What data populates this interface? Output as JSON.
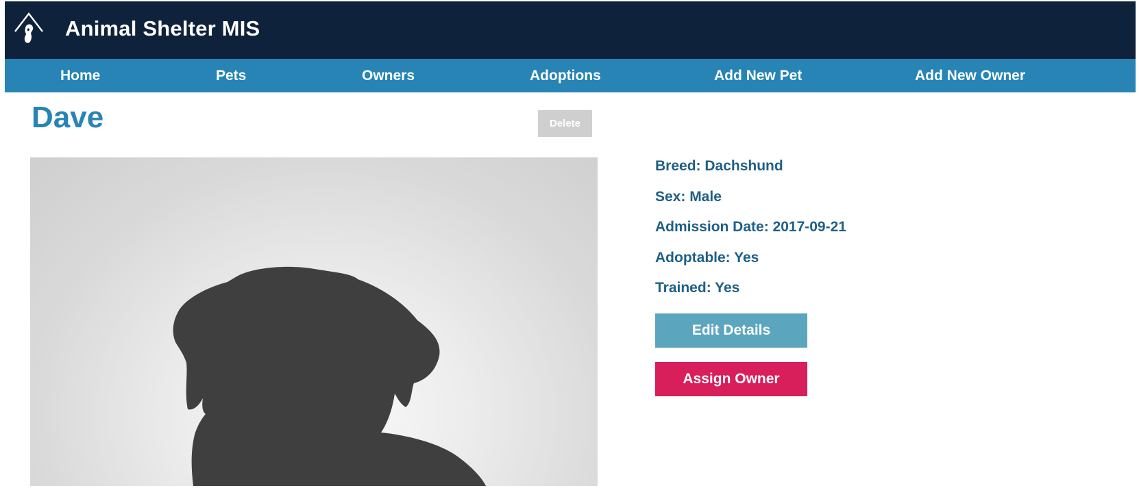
{
  "app": {
    "title": "Animal Shelter MIS",
    "logo_icon": "dog-house-logo-icon"
  },
  "nav": {
    "items": [
      {
        "label": "Home"
      },
      {
        "label": "Pets"
      },
      {
        "label": "Owners"
      },
      {
        "label": "Adoptions"
      },
      {
        "label": "Add New Pet"
      },
      {
        "label": "Add New Owner"
      }
    ]
  },
  "pet": {
    "name": "Dave",
    "photo_icon": "dog-silhouette-placeholder",
    "details": [
      {
        "text": "Breed: Dachshund"
      },
      {
        "text": "Sex: Male"
      },
      {
        "text": "Admission Date: 2017-09-21"
      },
      {
        "text": "Adoptable: Yes"
      },
      {
        "text": "Trained: Yes"
      }
    ]
  },
  "actions": {
    "delete_label": "Delete",
    "edit_label": "Edit Details",
    "assign_label": "Assign Owner"
  },
  "colors": {
    "header_bg": "#0e223b",
    "nav_bg": "#2784b5",
    "accent": "#2784b5",
    "detail_text": "#1f5f86",
    "edit_button": "#5ba5bf",
    "assign_button": "#d81f5b",
    "delete_button_disabled": "#cfcfcf"
  }
}
